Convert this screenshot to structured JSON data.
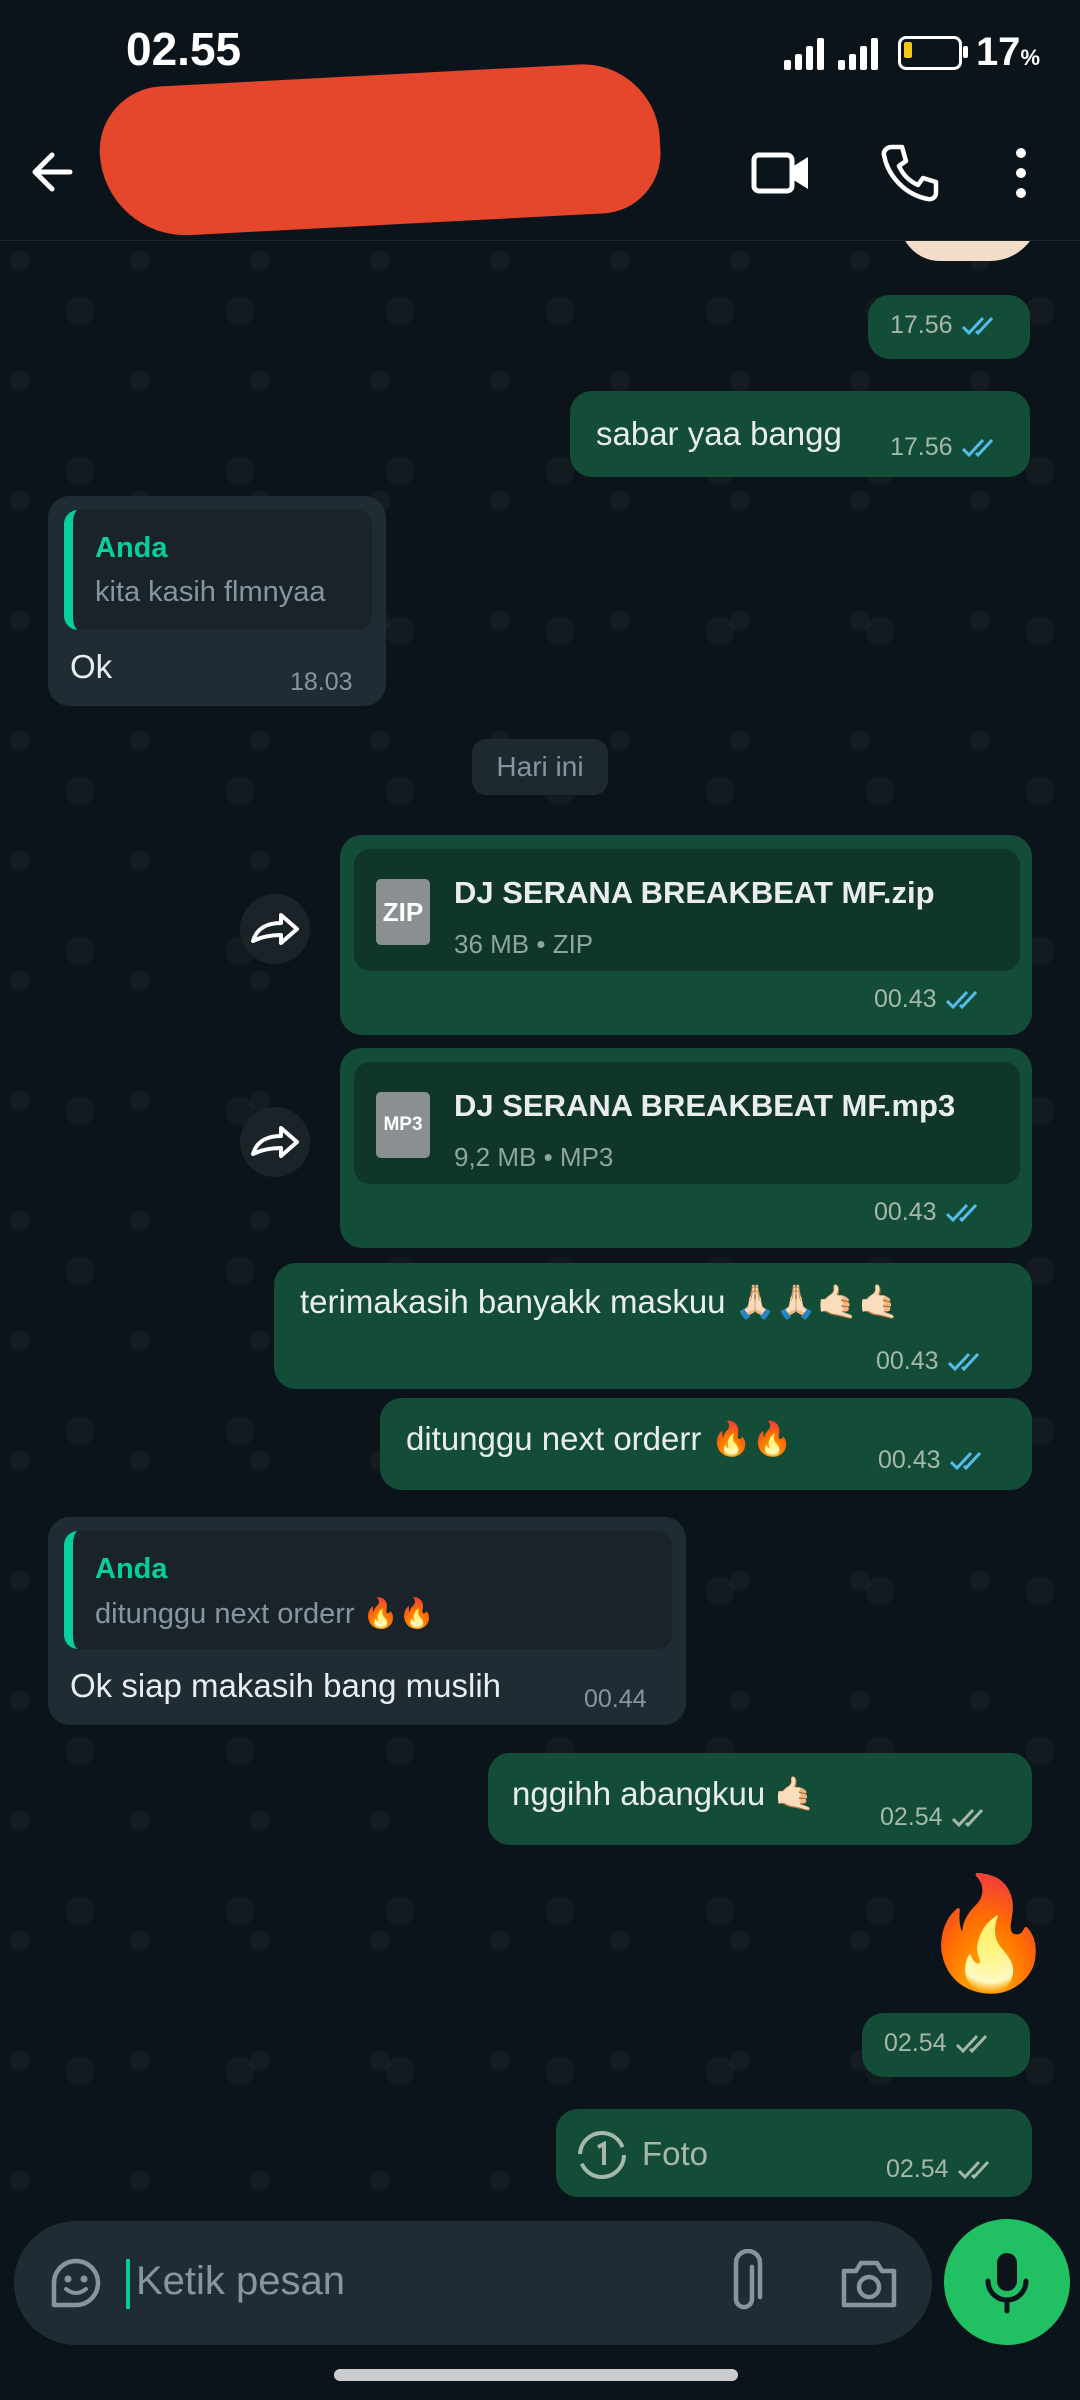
{
  "status_bar": {
    "time": "02.55",
    "battery_pct": "17",
    "battery_unit": "%"
  },
  "header": {
    "contact_name_redacted": true
  },
  "messages": {
    "m1": {
      "time": "17.56"
    },
    "m2": {
      "text": "sabar yaa bangg",
      "time": "17.56"
    },
    "m3": {
      "quote_name": "Anda",
      "quote_text": "kita kasih flmnyaa",
      "text": "Ok",
      "time": "18.03"
    },
    "date_separator": "Hari ini",
    "m4": {
      "file_name": "DJ SERANA BREAKBEAT MF.zip",
      "file_meta": "36 MB • ZIP",
      "icon_label": "ZIP",
      "time": "00.43"
    },
    "m5": {
      "file_name": "DJ SERANA BREAKBEAT MF.mp3",
      "file_meta": "9,2 MB • MP3",
      "icon_label": "MP3",
      "time": "00.43"
    },
    "m6": {
      "text": "terimakasih banyakk maskuu 🙏🏻🙏🏻🤙🏻🤙🏻",
      "time": "00.43"
    },
    "m7": {
      "text": "ditunggu next orderr 🔥🔥",
      "time": "00.43"
    },
    "m8": {
      "quote_name": "Anda",
      "quote_text": "ditunggu next orderr 🔥🔥",
      "text": "Ok siap makasih bang muslih",
      "time": "00.44"
    },
    "m9": {
      "text": "nggihh abangkuu 🤙🏻",
      "time": "02.54"
    },
    "m10": {
      "emoji": "🔥",
      "time": "02.54"
    },
    "m11": {
      "text": "Foto",
      "time": "02.54"
    }
  },
  "input": {
    "placeholder": "Ketik pesan"
  },
  "colors": {
    "outgoing_bubble": "#144d37",
    "incoming_bubble": "#1f2c34",
    "accent": "#06cf9c",
    "read_tick": "#53bdeb",
    "mic_button": "#21c063"
  }
}
